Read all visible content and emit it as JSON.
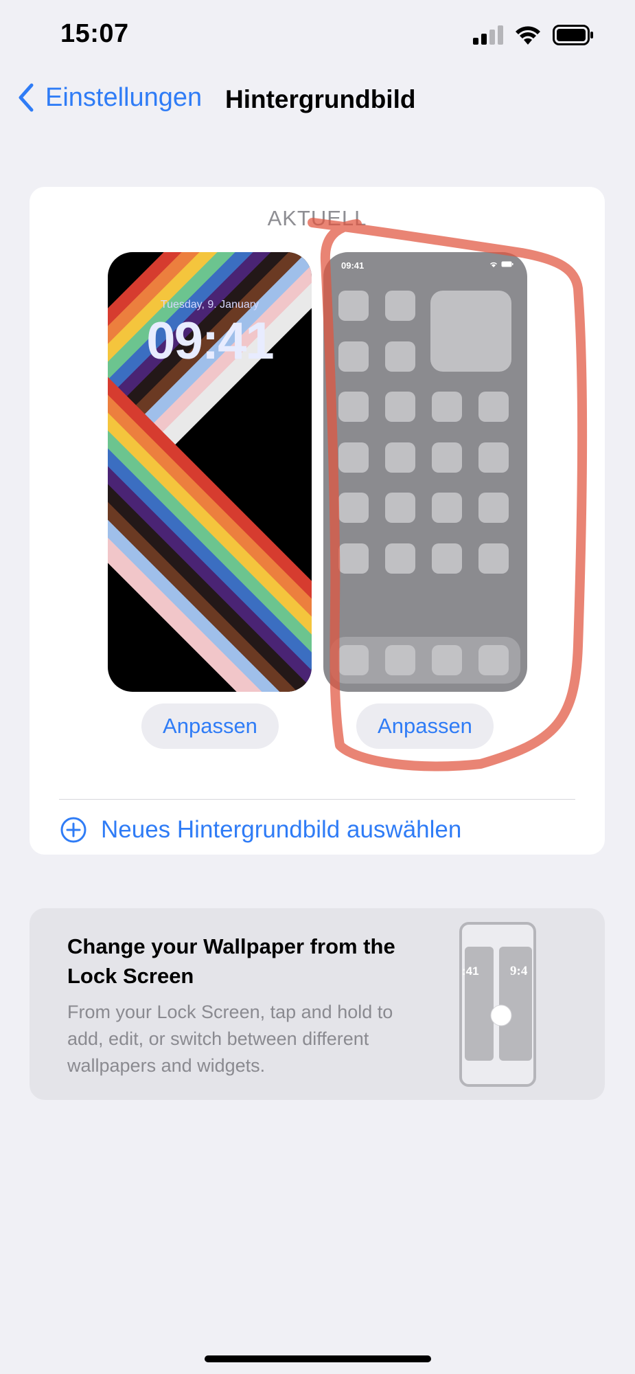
{
  "status_bar": {
    "time": "15:07",
    "icons": [
      "cellular-signal-icon",
      "wifi-icon",
      "battery-icon"
    ]
  },
  "nav": {
    "back_label": "Einstellungen",
    "title": "Hintergrundbild"
  },
  "current": {
    "section_label": "AKTUELL",
    "lock_preview": {
      "date": "Tuesday, 9. January",
      "time": "09:41",
      "customize_label": "Anpassen"
    },
    "home_preview": {
      "status_time": "09:41",
      "customize_label": "Anpassen"
    },
    "new_wallpaper_label": "Neues Hintergrundbild auswählen"
  },
  "tip": {
    "title": "Change your Wallpaper from the Lock Screen",
    "body": "From your Lock Screen, tap and hold to add, edit, or switch between different wallpapers and widgets.",
    "illustration_left_time": ":41",
    "illustration_right_time": "9:4"
  },
  "colors": {
    "accent": "#2f7cf6",
    "background": "#f0f0f5",
    "annotation": "#e0553f"
  }
}
